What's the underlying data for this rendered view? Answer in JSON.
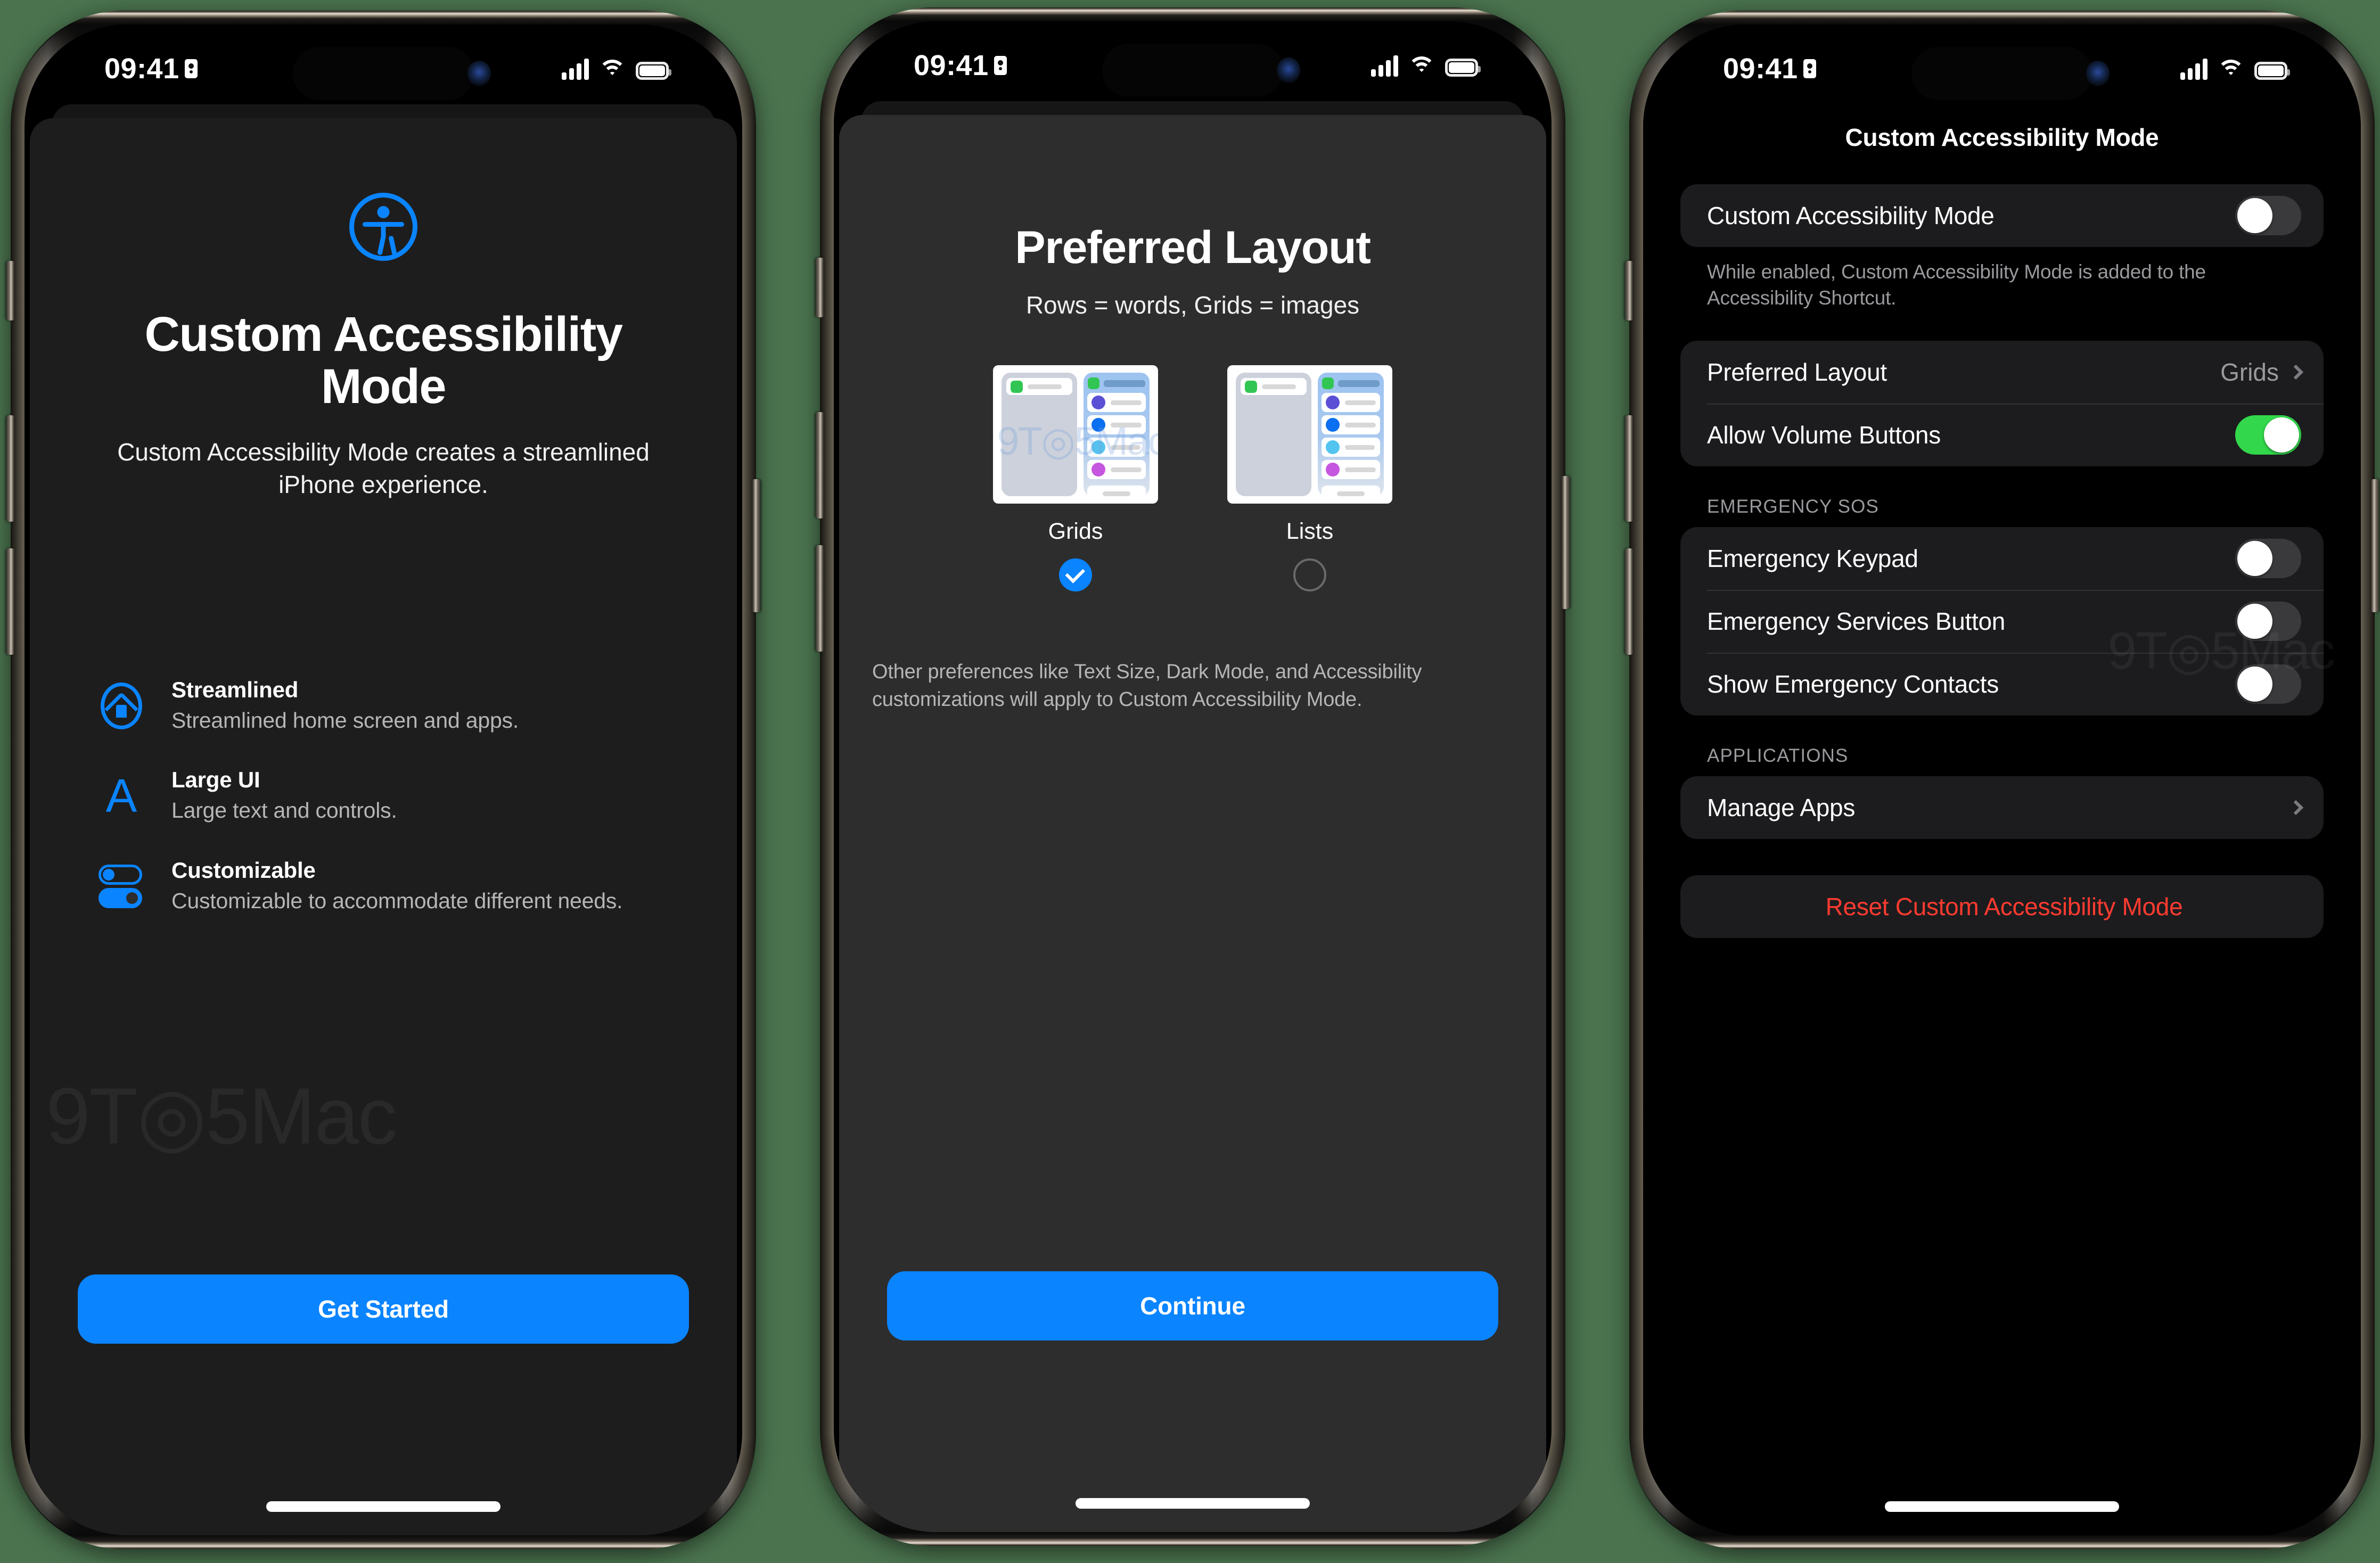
{
  "status_bar": {
    "time": "09:41",
    "icons": [
      "id-card-icon",
      "dynamic-island",
      "camera-indicator-dot",
      "cellular-signal-icon",
      "wifi-icon",
      "battery-icon"
    ]
  },
  "watermark": "9T◎5Mac",
  "colors": {
    "accent_blue": "#0a84ff",
    "toggle_on_green": "#32d74b",
    "destructive_red": "#ff3b30",
    "sheet_bg": "#2d2d2d",
    "group_bg": "#1c1c1e",
    "backdrop_green": "#4a734e"
  },
  "phone1": {
    "icon": "accessibility-icon",
    "title": "Custom Accessibility Mode",
    "subtitle": "Custom Accessibility Mode creates a streamlined iPhone experience.",
    "features": [
      {
        "icon": "home-icon",
        "title": "Streamlined",
        "desc": "Streamlined home screen and apps."
      },
      {
        "icon": "letter-a-icon",
        "title": "Large UI",
        "desc": "Large text and controls."
      },
      {
        "icon": "toggles-icon",
        "title": "Customizable",
        "desc": "Customizable to accommodate different needs."
      }
    ],
    "cta_label": "Get Started"
  },
  "phone2": {
    "title": "Preferred Layout",
    "subtitle": "Rows = words, Grids = images",
    "options": [
      {
        "label": "Grids",
        "selected": true
      },
      {
        "label": "Lists",
        "selected": false
      }
    ],
    "note": "Other preferences like Text Size, Dark Mode, and Accessibility customizations will apply to Custom Accessibility Mode.",
    "cta_label": "Continue"
  },
  "phone3": {
    "nav_title": "Custom Accessibility Mode",
    "group1": {
      "rows": [
        {
          "label": "Custom Accessibility Mode",
          "control": "toggle",
          "value": "off"
        }
      ],
      "note": "While enabled, Custom Accessibility Mode is added to the Accessibility Shortcut."
    },
    "group2": {
      "rows": [
        {
          "label": "Preferred Layout",
          "control": "disclosure",
          "value": "Grids"
        },
        {
          "label": "Allow Volume Buttons",
          "control": "toggle",
          "value": "on"
        }
      ]
    },
    "group3": {
      "header": "EMERGENCY SOS",
      "rows": [
        {
          "label": "Emergency Keypad",
          "control": "toggle",
          "value": "off"
        },
        {
          "label": "Emergency Services Button",
          "control": "toggle",
          "value": "off"
        },
        {
          "label": "Show Emergency Contacts",
          "control": "toggle",
          "value": "off"
        }
      ]
    },
    "group4": {
      "header": "APPLICATIONS",
      "rows": [
        {
          "label": "Manage Apps",
          "control": "disclosure",
          "value": ""
        }
      ]
    },
    "reset_label": "Reset Custom Accessibility Mode"
  }
}
